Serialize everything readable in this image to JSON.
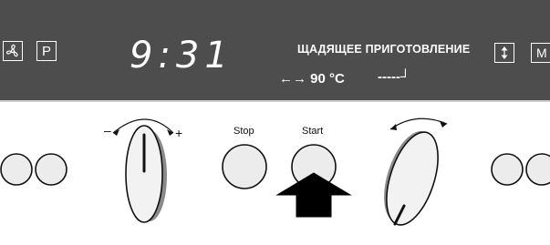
{
  "display": {
    "time": "9:31",
    "mode_text": "ЩАДЯЩЕЕ ПРИГОТОВЛЕНИЕ",
    "temperature": "90 °C",
    "temp_arrows": "←→",
    "heating_indicator": "-----┘",
    "p_label": "P",
    "m_label": "M"
  },
  "icons": {
    "fan": "fan-icon",
    "p": "p-symbol-icon",
    "selection_arrows": "selection-arrows-icon",
    "m": "m-symbol-icon",
    "press_arrow": "press-arrow-icon"
  },
  "buttons": {
    "stop_label": "Stop",
    "start_label": "Start"
  },
  "knob_marks": {
    "minus": "–",
    "plus": "+"
  },
  "colors": {
    "display_bg": "#4d4d4d",
    "display_text": "#ffffff",
    "panel_bg": "#ffffff",
    "button_fill": "#ececec",
    "knob_fill": "#f2f2f2",
    "knob_shadow": "#8a8a8a",
    "arrow": "#000000"
  }
}
